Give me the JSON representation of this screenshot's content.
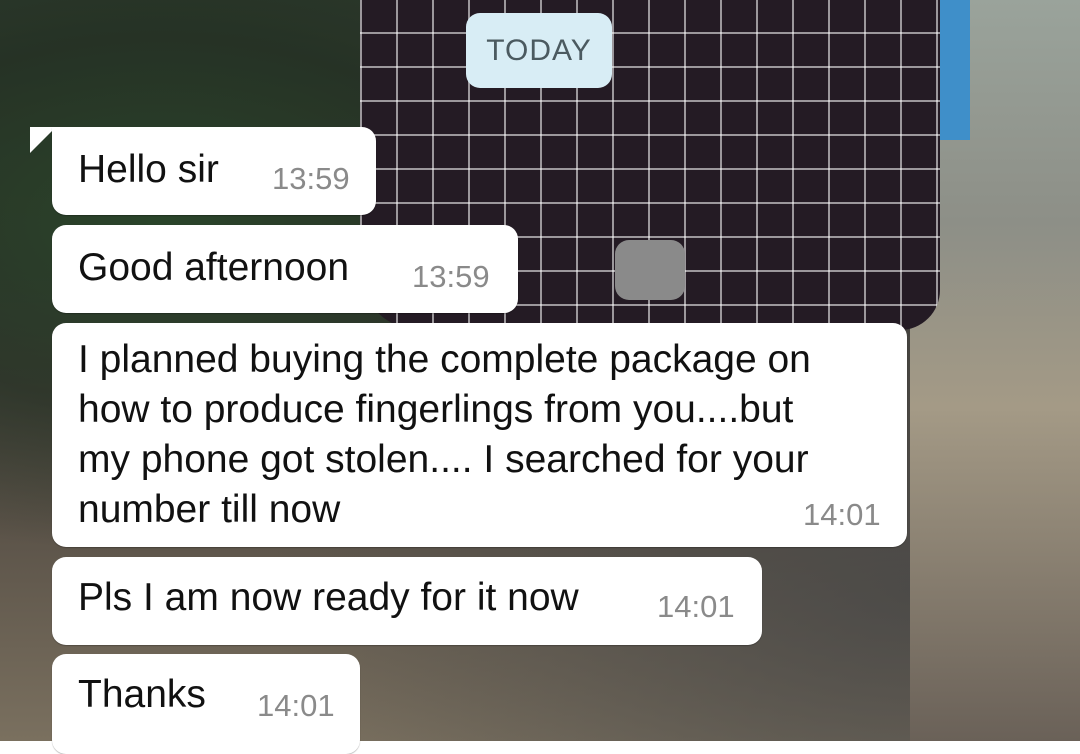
{
  "date_divider": "TODAY",
  "messages": [
    {
      "text": "Hello sir",
      "time": "13:59"
    },
    {
      "text": "Good afternoon",
      "time": "13:59"
    },
    {
      "text": "I planned buying the complete package on\nhow to produce fingerlings from you....but\nmy phone got stolen.... I searched for your\nnumber till now",
      "time": "14:01"
    },
    {
      "text": "Pls I am now ready for it now",
      "time": "14:01"
    },
    {
      "text": "Thanks",
      "time": "14:01"
    }
  ],
  "colors": {
    "bubble_incoming": "#ffffff",
    "date_chip": "#d8edf5",
    "timestamp": "#8a8a8a"
  }
}
